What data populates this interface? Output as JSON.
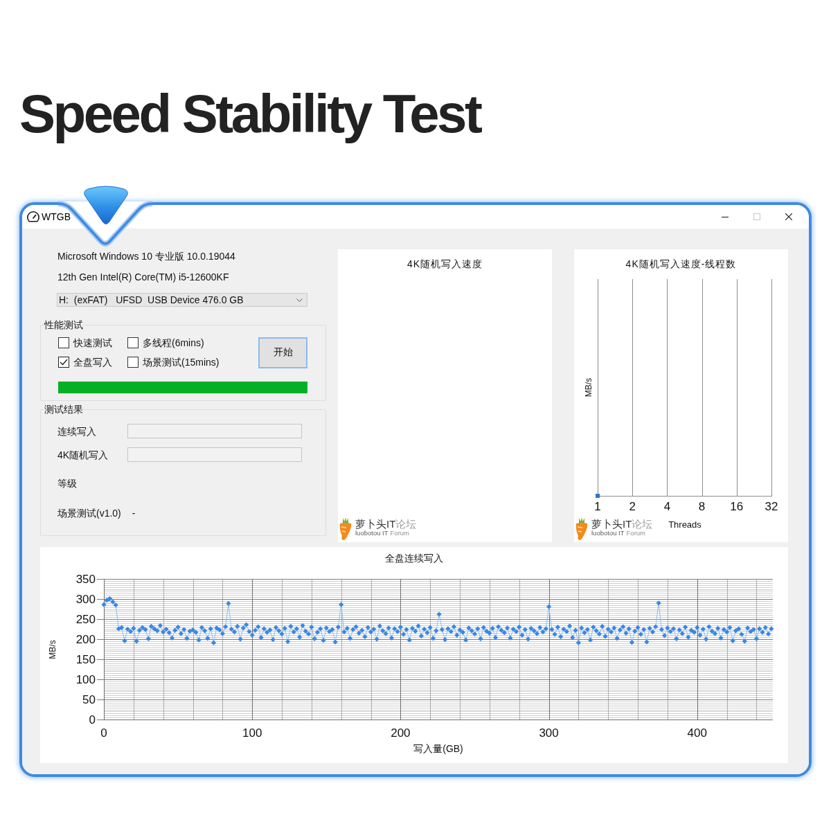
{
  "heading": "Speed Stability Test",
  "window": {
    "title": "WTGB",
    "controls": [
      {
        "kind": "minimize",
        "disabled": false
      },
      {
        "kind": "maximize",
        "disabled": true
      },
      {
        "kind": "close",
        "disabled": false
      }
    ]
  },
  "system_info": [
    "Microsoft Windows 10 专业版 10.0.19044",
    "12th Gen Intel(R) Core(TM) i5-12600KF"
  ],
  "drive_select": {
    "value": "H:  (exFAT)   UFSD  USB Device 476.0 GB"
  },
  "performance_test": {
    "title": "性能测试",
    "options": [
      {
        "label": "快速测试",
        "checked": false
      },
      {
        "label": "多线程(6mins)",
        "checked": false
      },
      {
        "label": "全盘写入",
        "checked": true
      },
      {
        "label": "场景测试(15mins)",
        "checked": false
      }
    ],
    "start_button": "开始",
    "progress": {
      "level": 1
    }
  },
  "results": {
    "title": "测试结果",
    "fields": [
      {
        "label": "连续写入"
      },
      {
        "label": "4K随机写入"
      }
    ],
    "grade_label": "等级",
    "scenario": {
      "label": "场景测试(v1.0)",
      "value": "-"
    }
  },
  "random_chart": {
    "title": "4K随机写入速度",
    "logo": {
      "name": "萝卜头IT",
      "name_suffix": "论坛",
      "subtitle": "luobotou IT",
      "subtitle_suffix": "Forum"
    }
  },
  "threads_chart": {
    "title": "4K随机写入速度-线程数",
    "ylabel": "MB/s",
    "x_tick_labels": [
      "1",
      "2",
      "4",
      "8",
      "16",
      "32"
    ],
    "logo": {
      "name": "萝卜头IT",
      "name_suffix": "论坛",
      "subtitle": "luobotou IT",
      "subtitle_suffix": "Forum"
    },
    "xlabel": "Threads"
  },
  "write_chart": {
    "chart_data": {
      "type": "line",
      "title": "全盘连续写入",
      "xlabel": "写入量(GB)",
      "ylabel": "MB/s",
      "grid": true,
      "marker": "diamond",
      "xlim": [
        0,
        451
      ],
      "ylim": [
        0,
        350
      ],
      "xticks": [
        0,
        100,
        200,
        300,
        400
      ],
      "yticks": [
        0,
        50,
        100,
        150,
        200,
        250,
        300,
        350
      ],
      "x": [
        0,
        2,
        4,
        6,
        8,
        10,
        12,
        14,
        16,
        18,
        20,
        22,
        24,
        26,
        28,
        30,
        32,
        34,
        36,
        38,
        40,
        42,
        44,
        46,
        48,
        50,
        52,
        54,
        56,
        58,
        60,
        62,
        64,
        66,
        68,
        70,
        72,
        74,
        76,
        78,
        80,
        82,
        84,
        86,
        88,
        90,
        92,
        94,
        96,
        98,
        100,
        102,
        104,
        106,
        108,
        110,
        112,
        114,
        116,
        118,
        120,
        122,
        124,
        126,
        128,
        130,
        132,
        134,
        136,
        138,
        140,
        142,
        144,
        146,
        148,
        150,
        152,
        154,
        156,
        158,
        160,
        162,
        164,
        166,
        168,
        170,
        172,
        174,
        176,
        178,
        180,
        182,
        184,
        186,
        188,
        190,
        192,
        194,
        196,
        198,
        200,
        202,
        204,
        206,
        208,
        210,
        212,
        214,
        216,
        218,
        220,
        222,
        224,
        226,
        228,
        230,
        232,
        234,
        236,
        238,
        240,
        242,
        244,
        246,
        248,
        250,
        252,
        254,
        256,
        258,
        260,
        262,
        264,
        266,
        268,
        270,
        272,
        274,
        276,
        278,
        280,
        282,
        284,
        286,
        288,
        290,
        292,
        294,
        296,
        298,
        300,
        302,
        304,
        306,
        308,
        310,
        312,
        314,
        316,
        318,
        320,
        322,
        324,
        326,
        328,
        330,
        332,
        334,
        336,
        338,
        340,
        342,
        344,
        346,
        348,
        350,
        352,
        354,
        356,
        358,
        360,
        362,
        364,
        366,
        368,
        370,
        372,
        374,
        376,
        378,
        380,
        382,
        384,
        386,
        388,
        390,
        392,
        394,
        396,
        398,
        400,
        402,
        404,
        406,
        408,
        410,
        412,
        414,
        416,
        418,
        420,
        422,
        424,
        426,
        428,
        430,
        432,
        434,
        436,
        438,
        440,
        442,
        444,
        446,
        448,
        450
      ],
      "values": [
        286,
        297,
        301,
        293,
        285,
        226,
        229,
        196,
        225,
        219,
        227,
        195,
        222,
        229,
        224,
        201,
        232,
        226,
        221,
        234,
        218,
        225,
        216,
        203,
        222,
        230,
        214,
        224,
        202,
        220,
        223,
        217,
        198,
        229,
        221,
        202,
        226,
        191,
        228,
        223,
        214,
        231,
        289,
        225,
        218,
        232,
        200,
        228,
        236,
        219,
        210,
        222,
        231,
        204,
        226,
        217,
        223,
        199,
        229,
        221,
        213,
        227,
        194,
        232,
        218,
        226,
        205,
        234,
        220,
        213,
        230,
        201,
        217,
        226,
        197,
        228,
        219,
        224,
        193,
        230,
        286,
        218,
        227,
        202,
        224,
        231,
        215,
        222,
        206,
        229,
        218,
        225,
        200,
        233,
        221,
        214,
        228,
        203,
        226,
        219,
        230,
        212,
        224,
        198,
        227,
        220,
        233,
        208,
        225,
        216,
        229,
        202,
        221,
        262,
        224,
        199,
        226,
        219,
        231,
        210,
        223,
        217,
        198,
        228,
        221,
        213,
        226,
        201,
        229,
        220,
        215,
        227,
        204,
        231,
        222,
        216,
        228,
        203,
        225,
        219,
        230,
        210,
        224,
        200,
        227,
        221,
        214,
        229,
        218,
        226,
        281,
        224,
        212,
        230,
        206,
        225,
        219,
        233,
        204,
        222,
        191,
        228,
        216,
        224,
        198,
        230,
        221,
        213,
        232,
        207,
        225,
        218,
        228,
        202,
        223,
        231,
        215,
        226,
        192,
        220,
        229,
        212,
        224,
        193,
        227,
        218,
        231,
        290,
        224,
        209,
        228,
        219,
        226,
        201,
        223,
        214,
        230,
        205,
        222,
        217,
        229,
        210,
        225,
        200,
        231,
        220,
        214,
        227,
        203,
        224,
        218,
        229,
        196,
        221,
        226,
        212,
        195,
        228,
        219,
        224,
        201,
        226,
        217,
        229,
        213,
        226
      ]
    }
  }
}
